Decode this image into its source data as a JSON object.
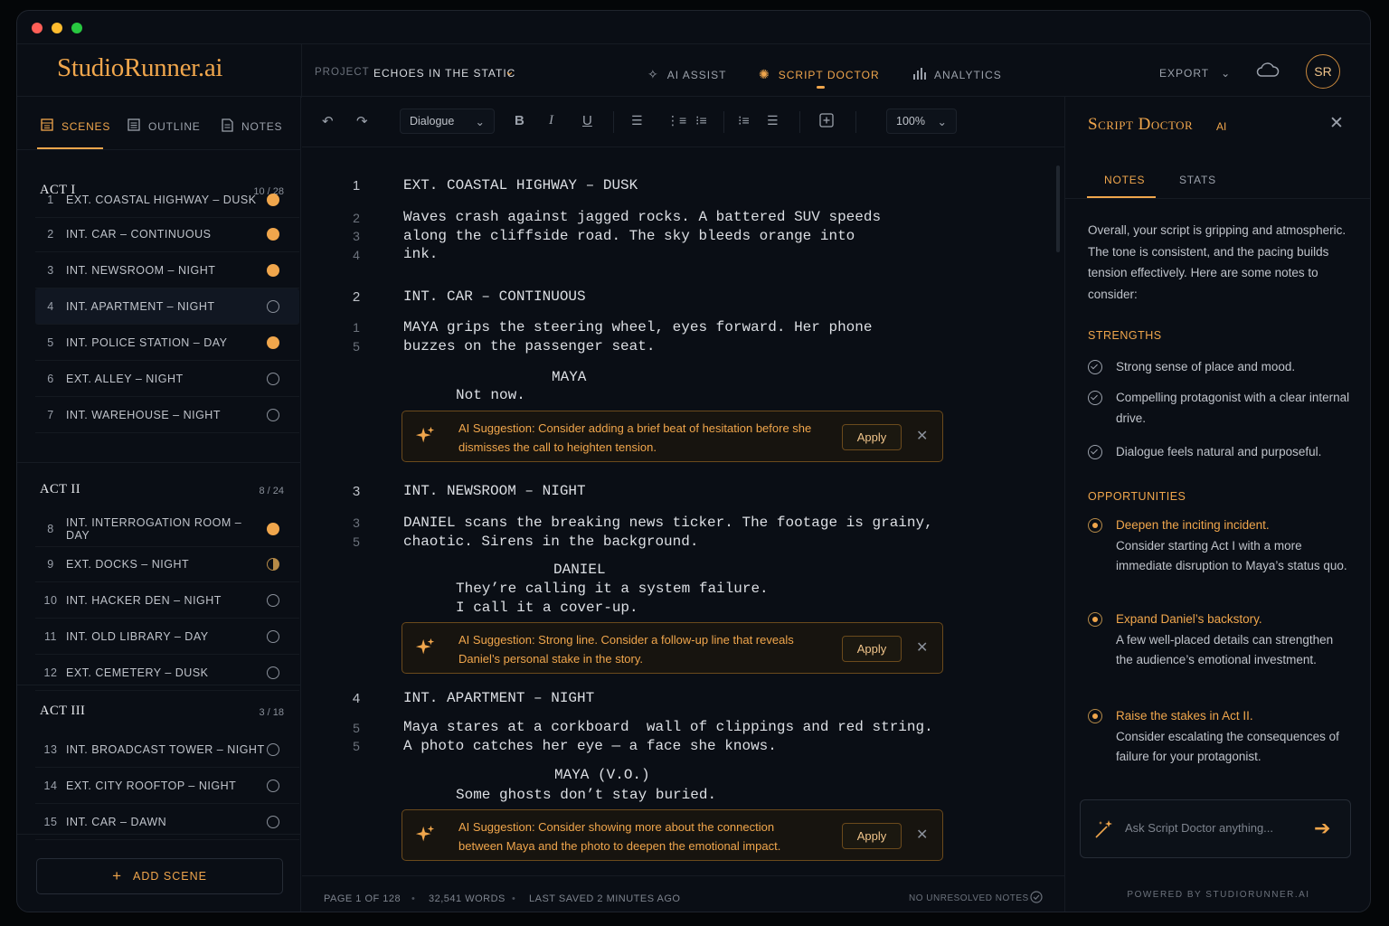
{
  "app": {
    "logo": "StudioRunner.ai",
    "window_controls": {
      "close": "#ff5f57",
      "minimize": "#febc2e",
      "maximize": "#28c840"
    },
    "accent": "#f0a64c"
  },
  "header": {
    "project_label": "PROJECT",
    "project_name": "ECHOES IN THE STATIC",
    "nav": [
      {
        "label": "AI ASSIST",
        "icon": "sparkle-icon"
      },
      {
        "label": "SCRIPT DOCTOR",
        "icon": "gear-sparkle-icon",
        "active": true
      },
      {
        "label": "ANALYTICS",
        "icon": "bar-chart-icon"
      }
    ],
    "export_label": "EXPORT",
    "avatar_initials": "SR"
  },
  "sidebar": {
    "tabs": [
      {
        "label": "SCENES",
        "icon": "film-icon",
        "active": true
      },
      {
        "label": "OUTLINE",
        "icon": "list-icon"
      },
      {
        "label": "NOTES",
        "icon": "note-icon"
      }
    ],
    "acts": [
      {
        "title": "ACT I",
        "count": "10 / 28",
        "scenes": [
          {
            "num": "1",
            "title": "EXT. COASTAL HIGHWAY – DUSK",
            "status": "full"
          },
          {
            "num": "2",
            "title": "INT. CAR – CONTINUOUS",
            "status": "full"
          },
          {
            "num": "3",
            "title": "INT. NEWSROOM – NIGHT",
            "status": "full"
          },
          {
            "num": "4",
            "title": "INT. APARTMENT – NIGHT",
            "status": "empty",
            "selected": true
          },
          {
            "num": "5",
            "title": "INT. POLICE STATION – DAY",
            "status": "full"
          },
          {
            "num": "6",
            "title": "EXT. ALLEY – NIGHT",
            "status": "empty"
          },
          {
            "num": "7",
            "title": "INT. WAREHOUSE – NIGHT",
            "status": "empty"
          }
        ]
      },
      {
        "title": "ACT II",
        "count": "8 / 24",
        "scenes": [
          {
            "num": "8",
            "title": "INT. INTERROGATION ROOM – DAY",
            "status": "full"
          },
          {
            "num": "9",
            "title": "EXT. DOCKS – NIGHT",
            "status": "half"
          },
          {
            "num": "10",
            "title": "INT. HACKER DEN – NIGHT",
            "status": "empty"
          },
          {
            "num": "11",
            "title": "INT. OLD LIBRARY – DAY",
            "status": "empty"
          },
          {
            "num": "12",
            "title": "EXT. CEMETERY – DUSK",
            "status": "empty"
          }
        ]
      },
      {
        "title": "ACT III",
        "count": "3 / 18",
        "scenes": [
          {
            "num": "13",
            "title": "INT. BROADCAST TOWER – NIGHT",
            "status": "empty"
          },
          {
            "num": "14",
            "title": "EXT. CITY ROOFTOP – NIGHT",
            "status": "empty"
          },
          {
            "num": "15",
            "title": "INT. CAR – DAWN",
            "status": "empty"
          }
        ]
      }
    ],
    "add_scene_label": "ADD SCENE"
  },
  "toolbar": {
    "element_type": "Dialogue",
    "zoom": "100%"
  },
  "script": {
    "scene1": {
      "num": "1",
      "heading": "EXT. COASTAL HIGHWAY – DUSK",
      "lines": [
        "2",
        "3",
        "4"
      ],
      "action": "Waves crash against jagged rocks. A battered SUV speeds\nalong the cliffside road. The sky bleeds orange into\nink."
    },
    "scene2": {
      "num": "2",
      "heading": "INT. CAR – CONTINUOUS",
      "lines": [
        "1",
        "5"
      ],
      "action": "MAYA grips the steering wheel, eyes forward. Her phone\nbuzzes on the passenger seat.",
      "character": "MAYA",
      "dialogue": "Not now."
    },
    "sug1": {
      "text": "AI Suggestion: Consider adding a brief beat of hesitation before she dismisses the call to heighten tension.",
      "apply": "Apply"
    },
    "scene3": {
      "num": "3",
      "heading": "INT. NEWSROOM – NIGHT",
      "lines": [
        "3",
        "5"
      ],
      "action": "DANIEL scans the breaking news ticker. The footage is grainy,\nchaotic. Sirens in the background.",
      "character": "DANIEL",
      "dialogue": "They’re calling it a system failure.\nI call it a cover-up."
    },
    "sug2": {
      "text": "AI Suggestion: Strong line. Consider a follow-up line that reveals Daniel’s personal stake in the story.",
      "apply": "Apply"
    },
    "scene4": {
      "num": "4",
      "heading": "INT. APARTMENT – NIGHT",
      "lines": [
        "5",
        "5"
      ],
      "action": "Maya stares at a corkboard  wall of clippings and red string.\nA photo catches her eye — a face she knows.",
      "character": "MAYA (V.O.)",
      "dialogue": "Some ghosts don’t stay buried."
    },
    "sug3": {
      "text": "AI Suggestion: Consider showing more about the connection between Maya and the photo to deepen the emotional impact.",
      "apply": "Apply"
    }
  },
  "status_bar": {
    "page": "PAGE 1 OF 128",
    "words": "32,541 WORDS",
    "saved": "LAST SAVED 2 MINUTES AGO",
    "notes": "NO UNRESOLVED NOTES"
  },
  "doctor": {
    "title": "Script Doctor",
    "badge": "AI",
    "tabs": [
      {
        "label": "NOTES",
        "active": true
      },
      {
        "label": "STATS"
      }
    ],
    "intro": "Overall, your script is gripping and atmospheric. The tone is consistent, and the pacing builds tension effectively. Here are some notes to consider:",
    "strengths_label": "STRENGTHS",
    "strengths": [
      "Strong sense of place and mood.",
      "Compelling protagonist with a clear internal drive.",
      "Dialogue feels natural and purposeful."
    ],
    "opportunities_label": "OPPORTUNITIES",
    "opportunities": [
      {
        "title": "Deepen the inciting incident.",
        "body": "Consider starting Act I with a more immediate disruption to Maya’s status quo."
      },
      {
        "title": "Expand Daniel’s backstory.",
        "body": "A few well-placed details can strengthen the audience’s emotional investment."
      },
      {
        "title": "Raise the stakes in Act II.",
        "body": "Consider escalating the consequences of failure for your protagonist."
      }
    ],
    "ask_placeholder": "Ask Script Doctor anything...",
    "powered_by": "POWERED BY STUDIORUNNER.AI"
  }
}
